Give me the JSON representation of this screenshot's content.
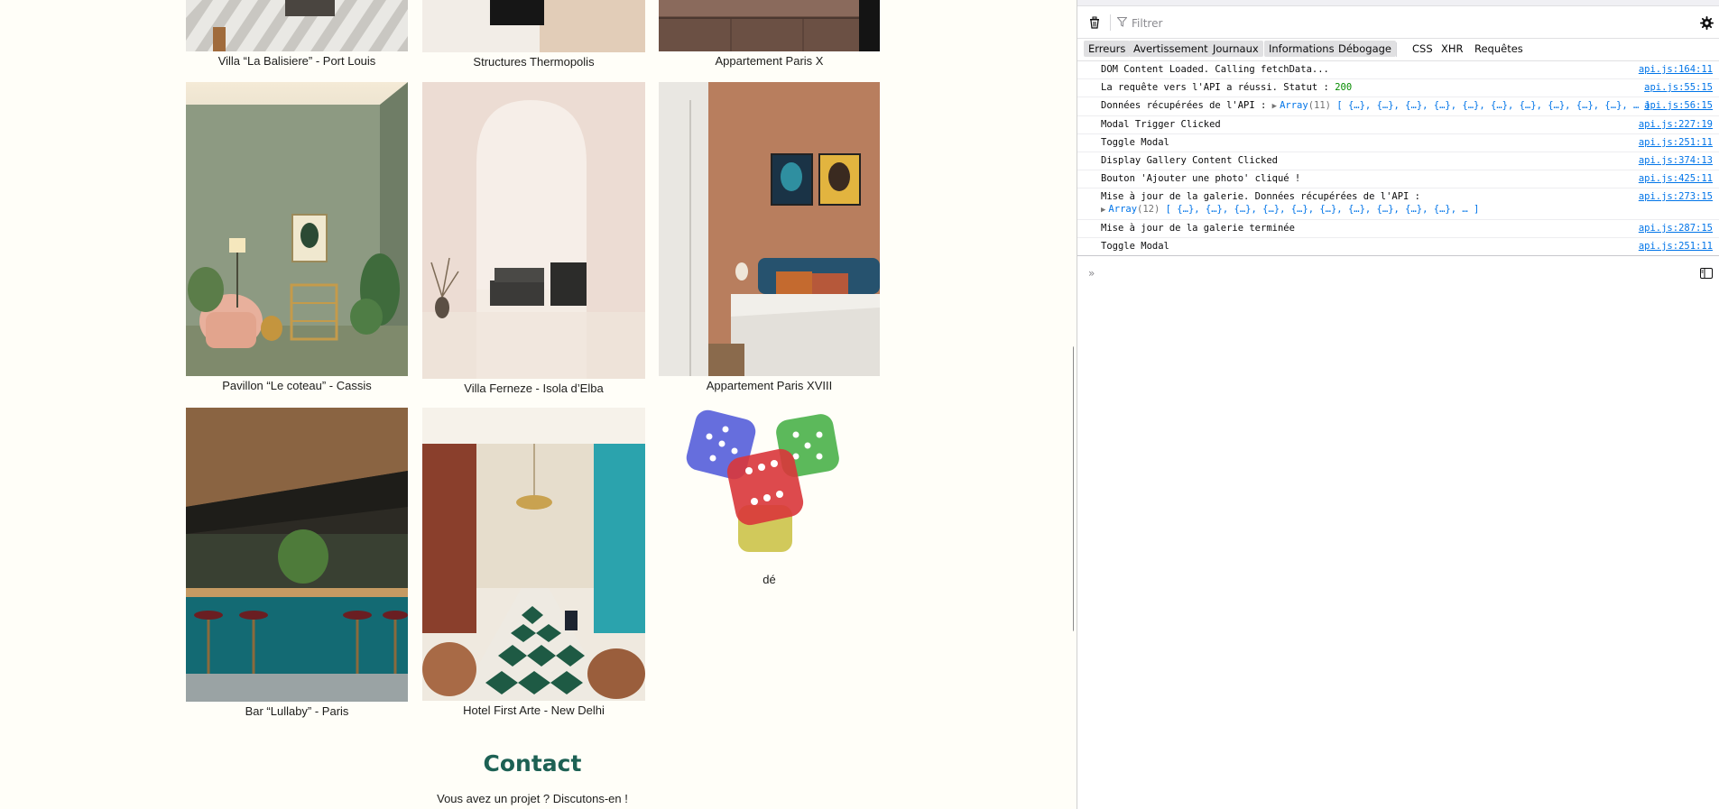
{
  "gallery": {
    "row1": [
      {
        "caption": "Villa “La Balisiere” - Port Louis"
      },
      {
        "caption": "Structures Thermopolis"
      },
      {
        "caption": "Appartement Paris X"
      }
    ],
    "row2": [
      {
        "caption": "Pavillon “Le coteau” - Cassis"
      },
      {
        "caption": "Villa Ferneze - Isola d’Elba"
      },
      {
        "caption": "Appartement Paris XVIII"
      }
    ],
    "row3": [
      {
        "caption": "Bar “Lullaby” - Paris"
      },
      {
        "caption": "Hotel First Arte - New Delhi"
      },
      {
        "caption": "dé"
      }
    ]
  },
  "contact": {
    "title": "Contact",
    "subtitle": "Vous avez un projet ? Discutons-en !"
  },
  "devtools": {
    "filter_placeholder": "Filtrer",
    "levels": [
      "Erreurs",
      "Avertissements",
      "Journaux",
      "Informations",
      "Débogage"
    ],
    "requests": [
      "CSS",
      "XHR",
      "Requêtes"
    ],
    "messages": [
      {
        "text": "DOM Content Loaded. Calling fetchData...",
        "source": "api.js:164:11"
      },
      {
        "text": "La requête vers l'API a réussi. Statut : ",
        "status": "200",
        "source": "api.js:55:15"
      },
      {
        "text": "Données récupérées de l'API : ",
        "array_label": "Array",
        "array_count": "(11)",
        "array_preview": "[ {…}, {…}, {…}, {…}, {…}, {…}, {…}, {…}, {…}, {…}, … ]",
        "source": "api.js:56:15"
      },
      {
        "text": "Modal Trigger Clicked",
        "source": "api.js:227:19"
      },
      {
        "text": "Toggle Modal",
        "source": "api.js:251:11"
      },
      {
        "text": "Display Gallery Content Clicked",
        "source": "api.js:374:13"
      },
      {
        "text": "Bouton 'Ajouter une photo' cliqué !",
        "source": "api.js:425:11"
      },
      {
        "text": "Mise à jour de la galerie. Données récupérées de l'API :",
        "array_label": "Array",
        "array_count": "(12)",
        "array_preview": "[ {…}, {…}, {…}, {…}, {…}, {…}, {…}, {…}, {…}, {…}, … ]",
        "source": "api.js:273:15"
      },
      {
        "text": "Mise à jour de la galerie terminée",
        "source": "api.js:287:15"
      },
      {
        "text": "Toggle Modal",
        "source": "api.js:251:11"
      }
    ],
    "prompt": "»"
  }
}
